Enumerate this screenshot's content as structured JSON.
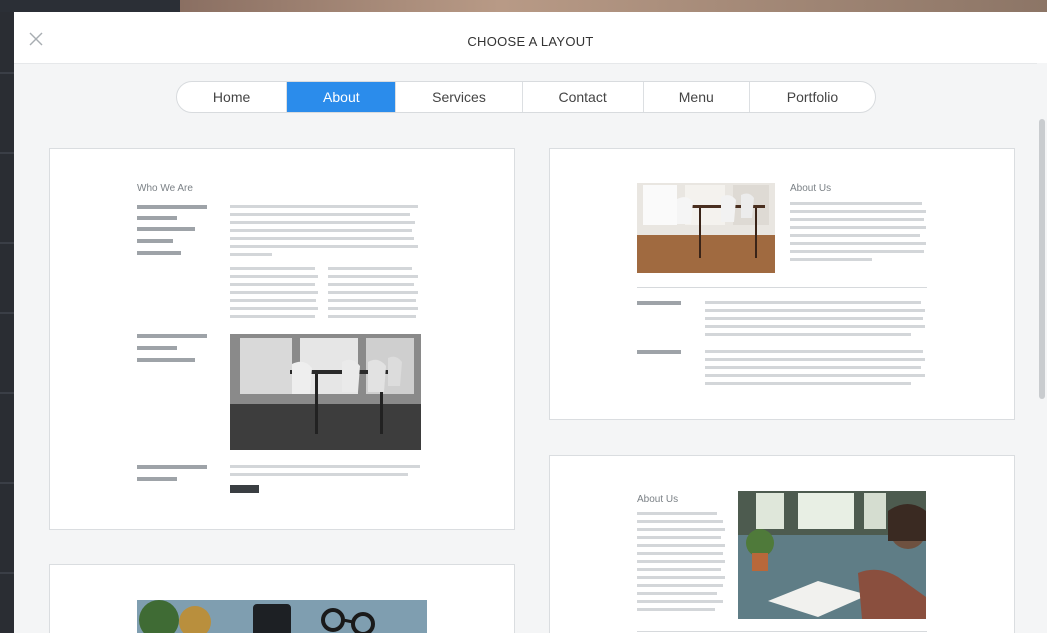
{
  "modal": {
    "title": "CHOOSE A LAYOUT",
    "close_icon": "close-icon"
  },
  "tabs": [
    {
      "label": "Home",
      "active": false
    },
    {
      "label": "About",
      "active": true
    },
    {
      "label": "Services",
      "active": false
    },
    {
      "label": "Contact",
      "active": false
    },
    {
      "label": "Menu",
      "active": false
    },
    {
      "label": "Portfolio",
      "active": false
    }
  ],
  "colors": {
    "accent": "#2b8ceb",
    "placeholder_line": "#d3d6d9",
    "placeholder_dark": "#9ea3a8",
    "modal_bg": "#f4f5f6"
  },
  "layouts": [
    {
      "heading": "Who We Are",
      "image": "dining-room-photo-grayscale"
    },
    {
      "heading": "About Us",
      "image": "dining-room-photo-color"
    },
    {
      "heading": "About Us",
      "image": "person-writing-at-desk-photo"
    },
    {
      "heading": "",
      "image": "desk-plants-glasses-photo"
    }
  ]
}
